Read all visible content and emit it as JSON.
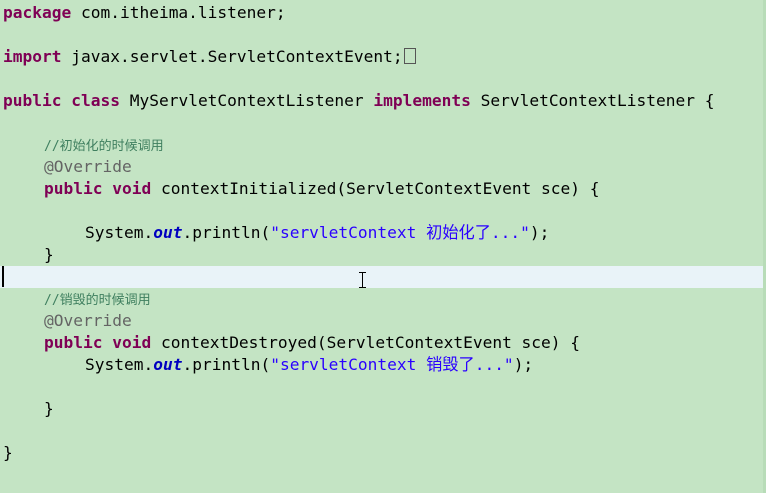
{
  "code": {
    "package": {
      "keyword": "package",
      "text": " com.itheima.listener;"
    },
    "import": {
      "keyword": "import",
      "text": " javax.servlet.ServletContextEvent;"
    },
    "class_decl": {
      "kw_public": "public",
      "kw_class": "class",
      "class_name": "MyServletContextListener",
      "kw_implements": "implements",
      "interface_name": "ServletContextListener",
      "open_brace": "{"
    },
    "init_method": {
      "comment": "//初始化的时候调用",
      "annotation": "@Override",
      "kw_public": "public",
      "kw_void": "void",
      "signature": "contextInitialized(ServletContextEvent sce) {",
      "stmt_prefix": "System.",
      "stmt_field": "out",
      "stmt_call": ".println(",
      "stmt_string": "\"servletContext 初始化了...\"",
      "stmt_suffix": ");",
      "close_brace": "}"
    },
    "destroy_method": {
      "comment": "//销毁的时候调用",
      "annotation": "@Override",
      "kw_public": "public",
      "kw_void": "void",
      "signature": "contextDestroyed(ServletContextEvent sce) {",
      "stmt_prefix": "System.",
      "stmt_field": "out",
      "stmt_call": ".println(",
      "stmt_string": "\"servletContext 销毁了...\"",
      "stmt_suffix": ");",
      "close_brace": "}"
    },
    "class_close": "}"
  },
  "colors": {
    "background": "#c4e4c4",
    "keyword": "#7f0055",
    "comment": "#3f7f5f",
    "annotation": "#646464",
    "string": "#2a00ff",
    "field": "#0000c0",
    "current_line": "#e9f3f8"
  },
  "icons": [
    "text-cursor-icon"
  ]
}
